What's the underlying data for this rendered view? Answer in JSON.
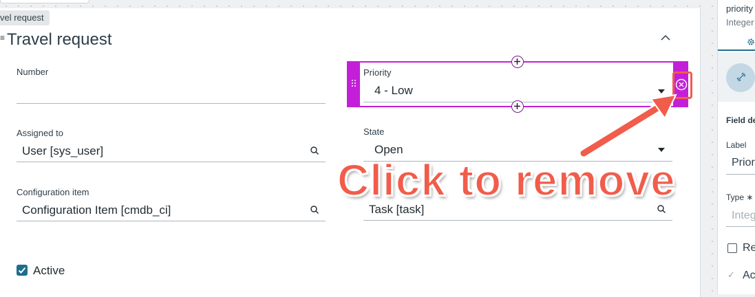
{
  "breadcrumb": "vel request",
  "form": {
    "section_title": "Travel request",
    "fields": {
      "number": {
        "label": "Number",
        "value": ""
      },
      "priority": {
        "label": "Priority",
        "value": "4 - Low"
      },
      "assigned_to": {
        "label": "Assigned to",
        "value": "User [sys_user]"
      },
      "state": {
        "label": "State",
        "value": "Open"
      },
      "configuration_item": {
        "label": "Configuration item",
        "value": "Configuration Item [cmdb_ci]"
      },
      "task": {
        "label": "",
        "value": "Task [task]"
      }
    },
    "active": {
      "label": "Active",
      "checked": true
    }
  },
  "annotation": {
    "text": "Click to remove",
    "color": "#f15c4b"
  },
  "right_panel": {
    "field_name": "priority",
    "field_type": "Integer",
    "section_heading": "Field de",
    "label_caption": "Label",
    "label_value": "Prior",
    "type_caption": "Type ∗",
    "type_value": "Integ",
    "checkbox_1_label": "Re",
    "checkbox_2_label": "Act"
  },
  "colors": {
    "selection": "#c41fd8",
    "accent": "#1b6e8c",
    "annotation": "#f15c4b"
  },
  "icons": [
    "collapse-chevron-icon",
    "search-icon",
    "dropdown-caret-icon",
    "drag-grip-icon",
    "add-field-plus-icon",
    "remove-field-icon",
    "gear-icon",
    "link-icon",
    "checkmark-icon"
  ]
}
